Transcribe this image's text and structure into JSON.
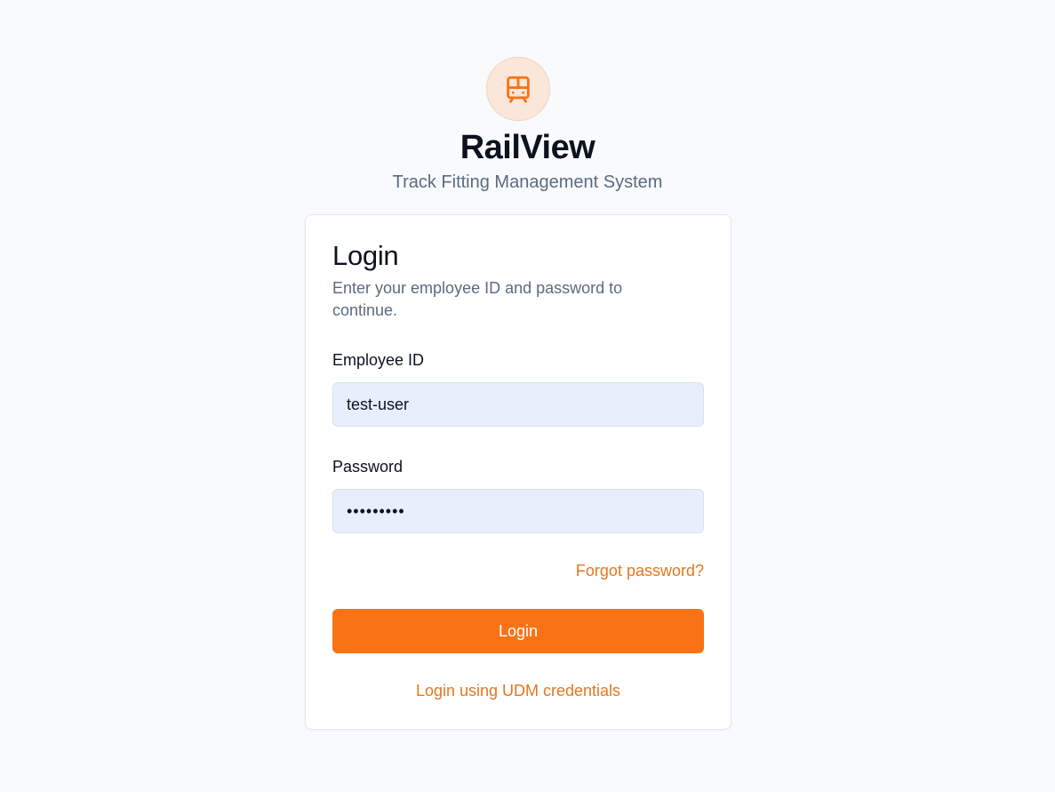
{
  "brand": {
    "title": "RailView",
    "subtitle": "Track Fitting Management System",
    "logo_icon": "train-icon",
    "accent_color": "#f97316"
  },
  "login_card": {
    "title": "Login",
    "description": "Enter your employee ID and password to continue.",
    "employee_id": {
      "label": "Employee ID",
      "value": "test-user"
    },
    "password": {
      "label": "Password",
      "value": "•••••••••"
    },
    "forgot_password_label": "Forgot password?",
    "login_button_label": "Login",
    "udm_login_label": "Login using UDM credentials"
  }
}
